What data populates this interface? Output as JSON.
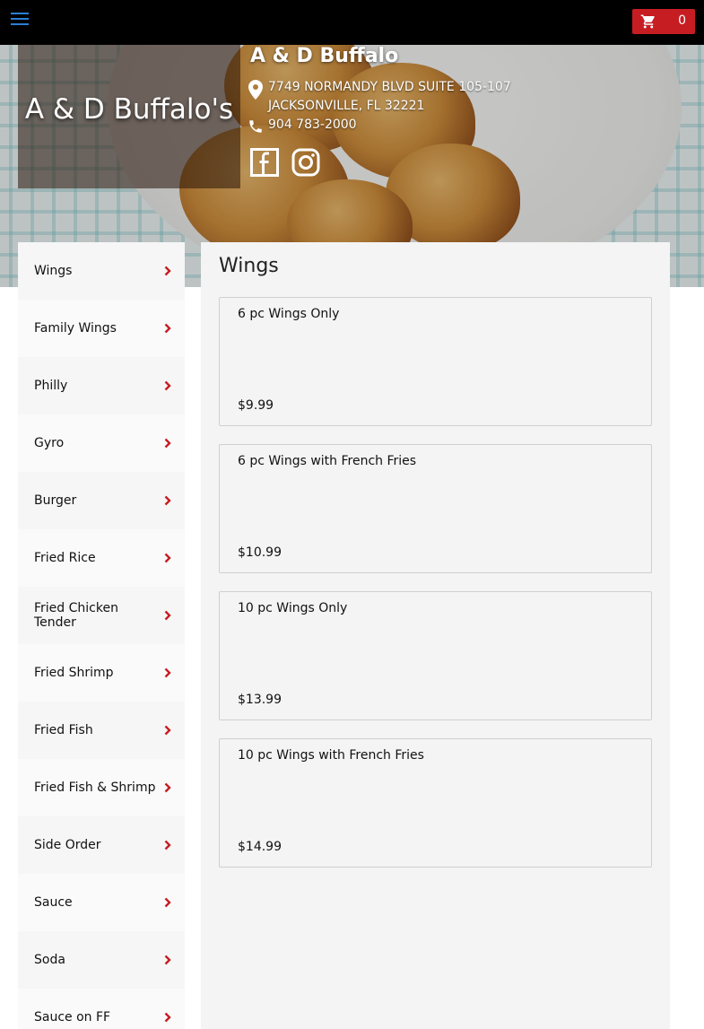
{
  "header": {
    "cart_count": "0",
    "accent": "#c61d23",
    "menu_color": "#2a7fd4"
  },
  "restaurant": {
    "logo_text": "A & D Buffalo's",
    "name": "A & D Buffalo",
    "address_line1": "7749 NORMANDY BLVD SUITE 105-107",
    "address_line2": "JACKSONVILLE, FL 32221",
    "phone": "904 783-2000"
  },
  "categories": [
    {
      "label": "Wings"
    },
    {
      "label": "Family Wings"
    },
    {
      "label": "Philly"
    },
    {
      "label": "Gyro"
    },
    {
      "label": "Burger"
    },
    {
      "label": "Fried Rice"
    },
    {
      "label": "Fried Chicken Tender"
    },
    {
      "label": "Fried Shrimp"
    },
    {
      "label": "Fried Fish"
    },
    {
      "label": "Fried Fish & Shrimp"
    },
    {
      "label": "Side Order"
    },
    {
      "label": "Sauce"
    },
    {
      "label": "Soda"
    },
    {
      "label": "Sauce on FF"
    }
  ],
  "menu": {
    "section_title": "Wings",
    "items": [
      {
        "name": "6 pc Wings Only",
        "price": "$9.99"
      },
      {
        "name": "6 pc Wings with French Fries",
        "price": "$10.99"
      },
      {
        "name": "10 pc Wings Only",
        "price": "$13.99"
      },
      {
        "name": "10 pc Wings with French Fries",
        "price": "$14.99"
      }
    ]
  }
}
